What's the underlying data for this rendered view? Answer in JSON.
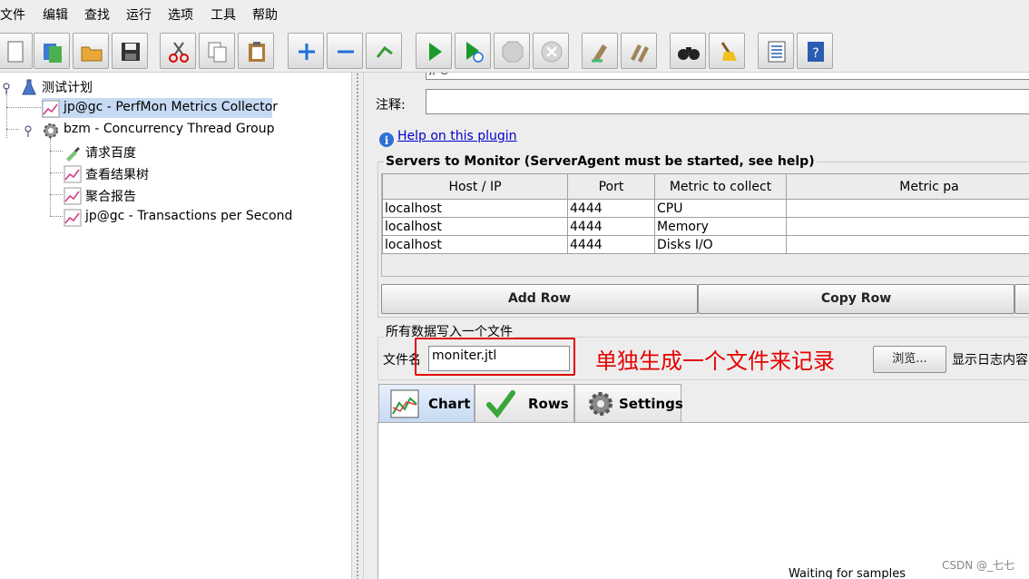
{
  "menu": [
    "文件",
    "编辑",
    "查找",
    "运行",
    "选项",
    "工具",
    "帮助"
  ],
  "toolbar_icons": [
    "new-icon",
    "templates-icon",
    "open-icon",
    "save-icon",
    "cut-icon",
    "copy-icon",
    "paste-icon",
    "expand-icon",
    "collapse-icon",
    "toggle-icon",
    "start-icon",
    "start-no-pause-icon",
    "stop-icon",
    "shutdown-icon",
    "clear-icon",
    "clear-all-icon",
    "search-icon",
    "reset-search-icon",
    "function-helper-icon",
    "help-icon"
  ],
  "tree": {
    "root": "测试计划",
    "perfmon": "jp@gc - PerfMon Metrics Collector",
    "thread_group": "bzm - Concurrency Thread Group",
    "request": "请求百度",
    "view_results": "查看结果树",
    "aggregate": "聚合报告",
    "tps": "jp@gc - Transactions per Second"
  },
  "panel": {
    "name_fragment": "jp@c",
    "comment_label": "注释:",
    "comment_value": "",
    "help_link": "Help on this plugin",
    "servers_title": "Servers to Monitor (ServerAgent must be started, see help)",
    "columns": [
      "Host / IP",
      "Port",
      "Metric to collect",
      "Metric pa"
    ],
    "rows": [
      [
        "localhost",
        "4444",
        "CPU",
        ""
      ],
      [
        "localhost",
        "4444",
        "Memory",
        ""
      ],
      [
        "localhost",
        "4444",
        "Disks I/O",
        ""
      ]
    ],
    "add_row": "Add Row",
    "copy_row": "Copy Row",
    "file_group_title": "所有数据写入一个文件",
    "file_label": "文件名",
    "file_value": "moniter.jtl",
    "browse": "浏览...",
    "log_label": "显示日志内容",
    "tabs": [
      "Chart",
      "Rows",
      "Settings"
    ],
    "waiting": "Waiting for samples"
  },
  "annotation": "单独生成一个文件来记录",
  "watermark": "CSDN @_七七",
  "colors": {
    "accent": "#c6daf3",
    "annotation_red": "#e60000",
    "link": "#0000cc"
  }
}
